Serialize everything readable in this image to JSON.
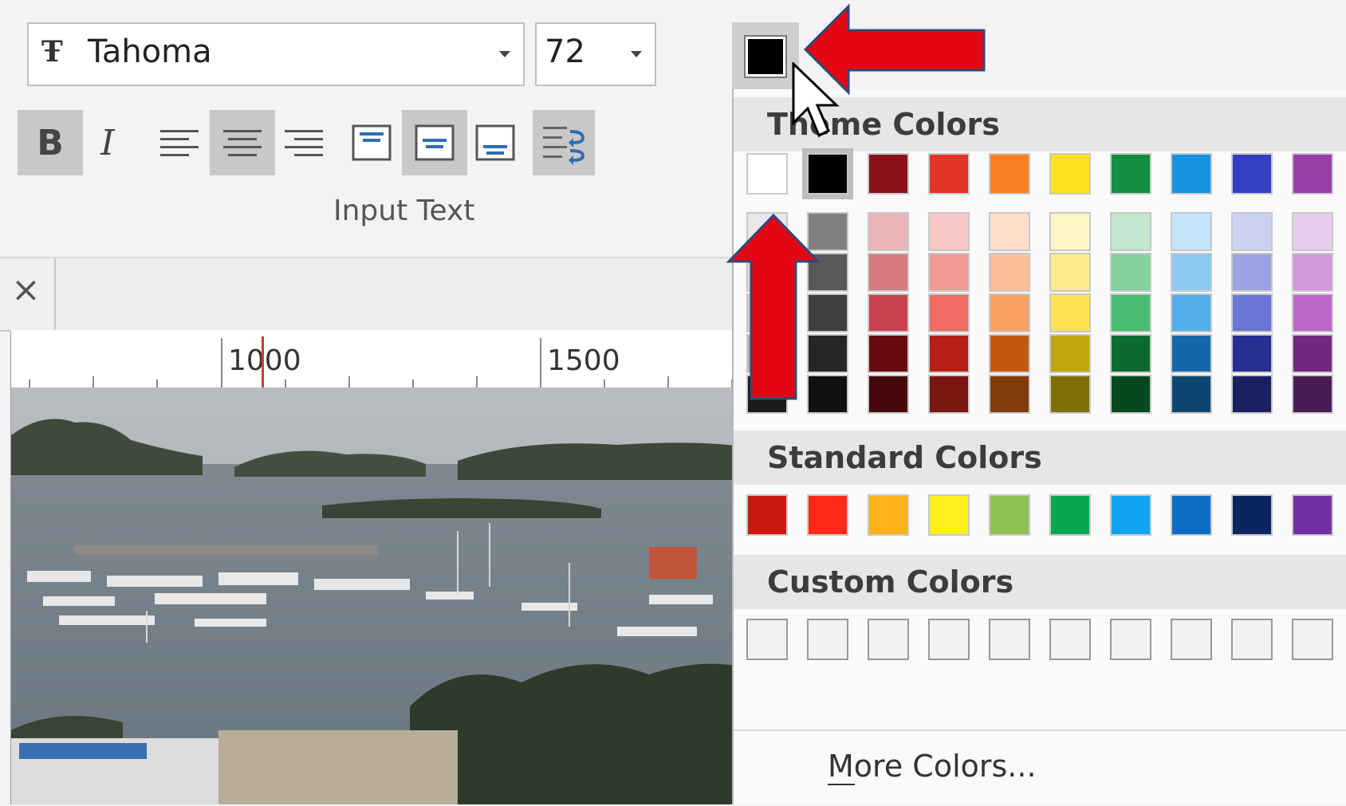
{
  "font_name_combo": {
    "value": "Tahoma",
    "icon": "truetype-font-icon"
  },
  "font_size_combo": {
    "value": "72"
  },
  "format_buttons": {
    "bold": "B",
    "italic": "I",
    "active": [
      "bold",
      "align-center",
      "valign-middle",
      "wrap-text"
    ]
  },
  "group_label": "Input Text",
  "tab_close": "×",
  "ruler": {
    "labels": [
      "1000",
      "1500"
    ]
  },
  "color_button": {
    "current_color": "#000000"
  },
  "color_menu": {
    "theme_title": "Theme Colors",
    "theme_top_row": [
      "#ffffff",
      "#000000",
      "#8b111b",
      "#e53227",
      "#fa7f25",
      "#fde11e",
      "#12903f",
      "#1892e2",
      "#3340c4",
      "#973ea9"
    ],
    "theme_shades": [
      [
        "#e8e8e8",
        "#d8d8d8",
        "#c6c6c6",
        "#aeaeae",
        "#1a1a1a"
      ],
      [
        "#7f7f7f",
        "#595959",
        "#3f3f3f",
        "#262626",
        "#111111"
      ],
      [
        "#e8b4b7",
        "#d87880",
        "#c9434e",
        "#68090f",
        "#450609"
      ],
      [
        "#f8c8c6",
        "#f49b96",
        "#ef6b63",
        "#b61f16",
        "#7a1510"
      ],
      [
        "#fedecb",
        "#fdbf97",
        "#fc9f62",
        "#c45810",
        "#833b0a"
      ],
      [
        "#fff5c7",
        "#fdeb8e",
        "#fde256",
        "#bfa60a",
        "#7f6f06"
      ],
      [
        "#c2e7cf",
        "#84d29e",
        "#47bc6e",
        "#0c6c2f",
        "#08481f"
      ],
      [
        "#c4e4f8",
        "#8bc9f1",
        "#51aee9",
        "#1268a8",
        "#0c4570"
      ],
      [
        "#cdd1f1",
        "#9ca3e3",
        "#6b75d5",
        "#262f92",
        "#191f61"
      ],
      [
        "#e8cced",
        "#d29ada",
        "#bb67c7",
        "#70287e",
        "#4b1b54"
      ]
    ],
    "standard_title": "Standard Colors",
    "standard": [
      "#c81a10",
      "#ff2a17",
      "#ffb21c",
      "#fff01d",
      "#8cc252",
      "#08a850",
      "#12a3ee",
      "#0b6dc4",
      "#0b2563",
      "#7330a6"
    ],
    "custom_title": "Custom Colors",
    "custom_count": 10,
    "more_label": "More Colors..."
  }
}
